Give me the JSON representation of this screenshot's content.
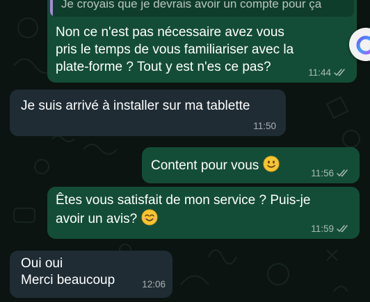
{
  "messages": [
    {
      "id": "b1",
      "direction": "outgoing",
      "quoted_text": "Je croyais que je devrais avoir un compte pour ça",
      "text": "Non ce n'est pas nécessaire avez vous\npris le temps de vous familiariser avec la\nplate-forme ? Tout y est n'es ce pas?",
      "time": "11:44",
      "status": "read-double-tick"
    },
    {
      "id": "b2",
      "direction": "incoming",
      "text": "Je suis arrivé à installer sur ma tablette",
      "time": "11:50"
    },
    {
      "id": "b3",
      "direction": "outgoing",
      "text": "Content pour vous",
      "emoji": "smiling-face-emoji",
      "time": "11:56",
      "status": "read-double-tick"
    },
    {
      "id": "b4",
      "direction": "outgoing",
      "text": "Êtes vous satisfait de mon service ? Puis-je\navoir un avis?",
      "emoji": "smiling-face-with-smiling-eyes-emoji",
      "time": "11:59",
      "status": "read-double-tick"
    },
    {
      "id": "b5",
      "direction": "incoming",
      "text": "Oui oui\nMerci beaucoup",
      "time": "12:06"
    }
  ],
  "colors": {
    "background": "#0b1411",
    "outgoing_bubble": "#144d37",
    "incoming_bubble": "#1f2c34",
    "quote_bar": "#a88ad8"
  },
  "floating_button_icon": "assistant-ring-icon"
}
